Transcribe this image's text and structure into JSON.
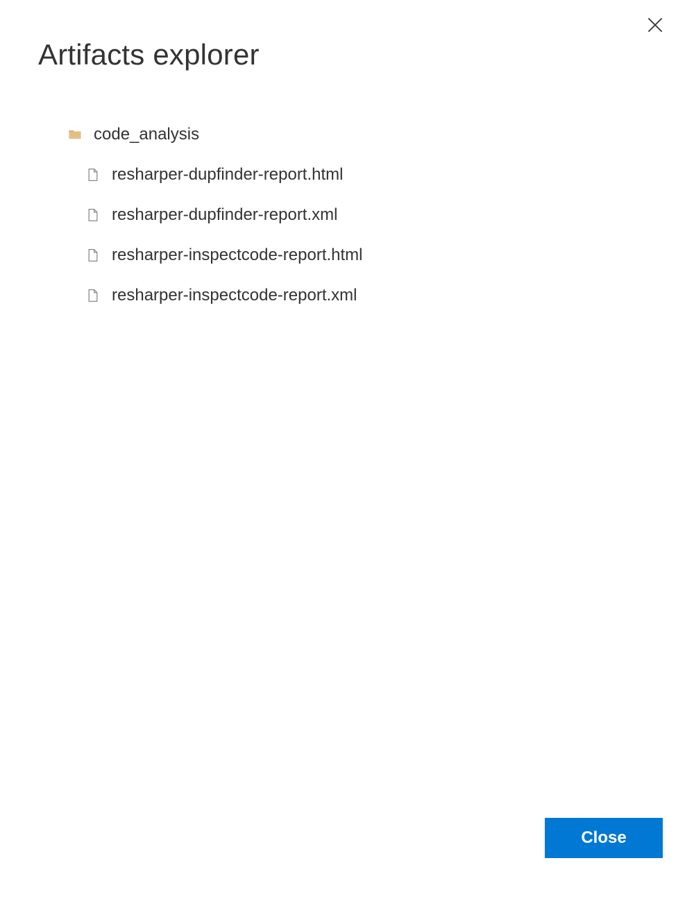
{
  "dialog": {
    "title": "Artifacts explorer",
    "close_button_label": "Close"
  },
  "tree": {
    "folder": {
      "name": "code_analysis",
      "icon": "folder-icon"
    },
    "files": [
      {
        "name": "resharper-dupfinder-report.html",
        "icon": "file-icon"
      },
      {
        "name": "resharper-dupfinder-report.xml",
        "icon": "file-icon"
      },
      {
        "name": "resharper-inspectcode-report.html",
        "icon": "file-icon"
      },
      {
        "name": "resharper-inspectcode-report.xml",
        "icon": "file-icon"
      }
    ]
  }
}
